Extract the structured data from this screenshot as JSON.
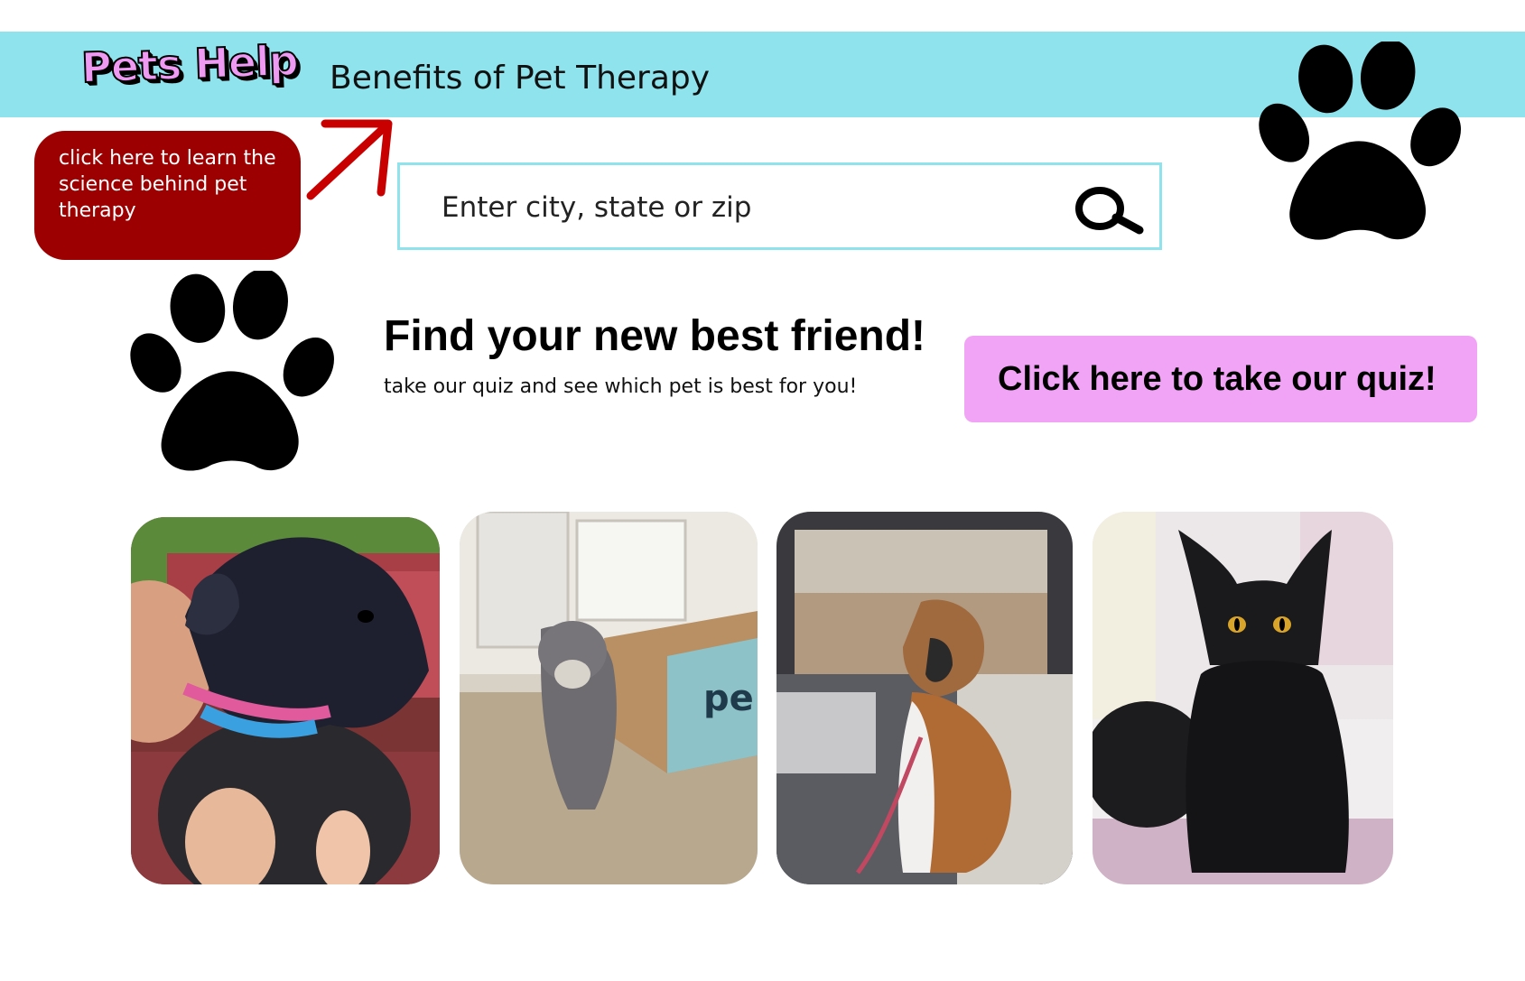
{
  "header": {
    "logo_text": "Pets Help",
    "nav_link": "Benefits of Pet Therapy",
    "bar_color": "#8ee3ec"
  },
  "tooltip": {
    "text": "click here to learn the science behind pet therapy",
    "color": "#9c0000"
  },
  "search": {
    "placeholder": "Enter city, state or zip",
    "icon": "search-icon"
  },
  "hero": {
    "headline": "Find your new best friend!",
    "subline": "take our quiz and see which pet is best for you!",
    "quiz_button": "Click here to take our quiz!",
    "quiz_button_color": "#f1a3f5"
  },
  "photos": [
    {
      "subject": "black puppy with pink leash"
    },
    {
      "subject": "gray long-haired cat by petco box"
    },
    {
      "subject": "boxer dog in car seat"
    },
    {
      "subject": "black kitten"
    }
  ]
}
